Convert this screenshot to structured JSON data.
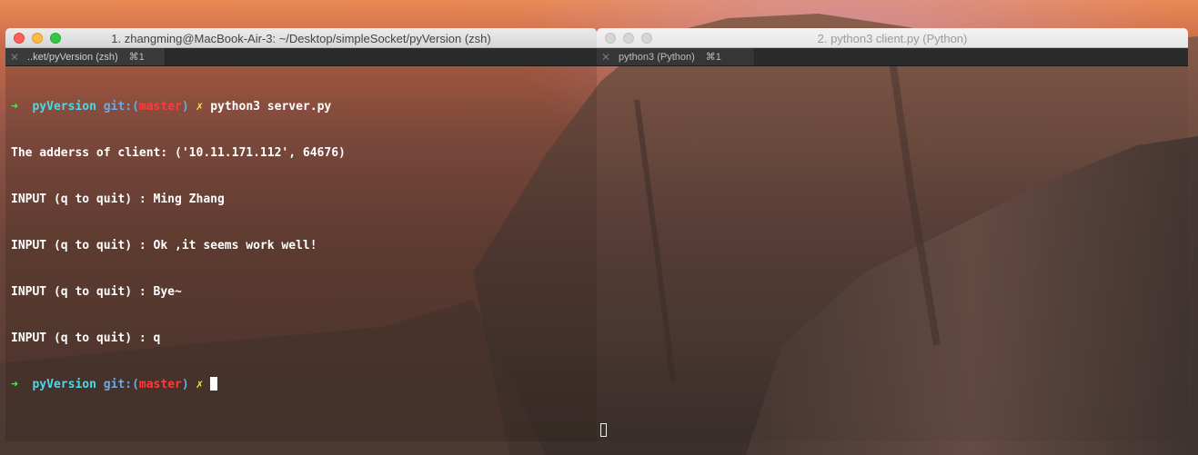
{
  "windows": [
    {
      "title": "1. zhangming@MacBook-Air-3: ~/Desktop/simpleSocket/pyVersion (zsh)",
      "tab": {
        "label": "..ket/pyVersion (zsh)",
        "shortcut": "⌘1",
        "close": "✕"
      },
      "terminal": {
        "prompt_line_1": {
          "arrow": "➜",
          "repo": "pyVersion",
          "git_open": " git:(",
          "branch": "master",
          "git_close": ")",
          "xmark": "✗",
          "command": "python3 server.py"
        },
        "output": [
          "The adderss of client: ('10.11.171.112', 64676)",
          "INPUT (q to quit) : Ming Zhang",
          "INPUT (q to quit) : Ok ,it seems work well!",
          "INPUT (q to quit) : Bye~",
          "INPUT (q to quit) : q"
        ],
        "prompt_line_2": {
          "arrow": "➜",
          "repo": "pyVersion",
          "git_open": " git:(",
          "branch": "master",
          "git_close": ")",
          "xmark": "✗"
        }
      }
    },
    {
      "title": "2. python3 client.py (Python)",
      "tab": {
        "label": "python3 (Python)",
        "shortcut": "⌘1",
        "close": "✕"
      }
    }
  ],
  "colors": {
    "prompt_arrow": "#5be35b",
    "repo_name": "#4dd8e8",
    "git_label": "#6fa8e8",
    "branch": "#ff3b3b",
    "dirty_mark": "#f2e64a"
  }
}
